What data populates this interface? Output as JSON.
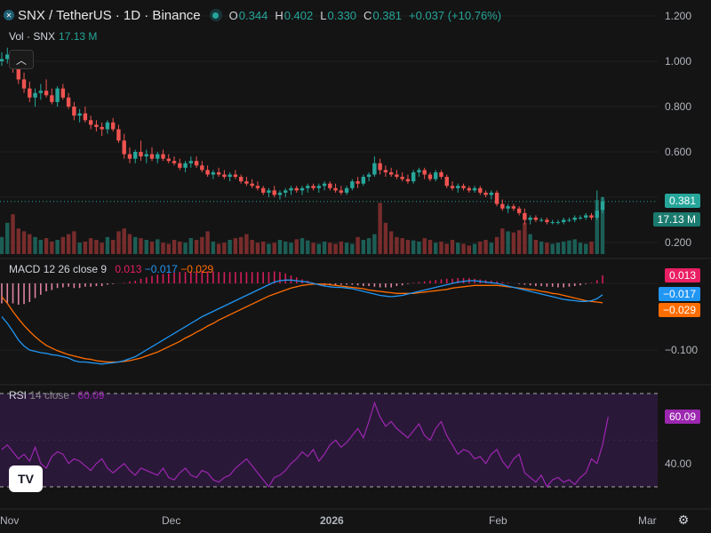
{
  "header": {
    "title": "SNX / TetherUS · 1D · Binance",
    "open_label": "O",
    "open": "0.344",
    "high_label": "H",
    "high": "0.402",
    "low_label": "L",
    "low": "0.330",
    "close_label": "C",
    "close": "0.381",
    "change": "+0.037 (+10.76%)"
  },
  "volume": {
    "label": "Vol · SNX",
    "value": "17.13 M"
  },
  "macd": {
    "label": "MACD",
    "params": "12 26 close 9",
    "hist": "0.013",
    "macd": "−0.017",
    "signal": "−0.029"
  },
  "rsi": {
    "label": "RSI",
    "params": "14 close",
    "value": "60.09"
  },
  "price_tags": {
    "last": "0.381",
    "volume": "17.13 M",
    "macd_hist": "0.013",
    "macd": "−0.017",
    "signal": "−0.029",
    "rsi": "60.09"
  },
  "colors": {
    "up": "#26a69a",
    "down": "#ef5350",
    "macd_line": "#2196f3",
    "signal_line": "#ff6d00",
    "macd_hist": "#e91e63",
    "rsi": "#9c27b0"
  },
  "chart_data": {
    "type": "candlestick",
    "price_axis": [
      {
        "value": 1.2,
        "label": "1.200"
      },
      {
        "value": 1.0,
        "label": "1.000"
      },
      {
        "value": 0.8,
        "label": "0.800"
      },
      {
        "value": 0.6,
        "label": "0.600"
      },
      {
        "value": 0.2,
        "label": "0.200"
      }
    ],
    "macd_axis": [
      {
        "value": -0.1,
        "label": "−0.100"
      }
    ],
    "rsi_axis": [
      {
        "value": 40,
        "label": "40.00"
      }
    ],
    "rsi_bands": [
      70,
      30
    ],
    "x_labels": [
      "Nov",
      "Dec",
      "2026",
      "Feb",
      "Mar"
    ],
    "ohlc": [
      [
        1.0,
        1.04,
        0.98,
        1.01
      ],
      [
        1.01,
        1.06,
        0.99,
        1.03
      ],
      [
        1.03,
        1.05,
        0.95,
        0.98
      ],
      [
        0.98,
        1.0,
        0.9,
        0.92
      ],
      [
        0.92,
        0.95,
        0.86,
        0.88
      ],
      [
        0.88,
        0.91,
        0.82,
        0.84
      ],
      [
        0.84,
        0.88,
        0.8,
        0.86
      ],
      [
        0.86,
        0.9,
        0.83,
        0.87
      ],
      [
        0.87,
        0.92,
        0.84,
        0.85
      ],
      [
        0.85,
        0.88,
        0.81,
        0.82
      ],
      [
        0.82,
        0.89,
        0.8,
        0.88
      ],
      [
        0.88,
        0.9,
        0.83,
        0.84
      ],
      [
        0.84,
        0.86,
        0.79,
        0.8
      ],
      [
        0.8,
        0.82,
        0.74,
        0.76
      ],
      [
        0.76,
        0.79,
        0.73,
        0.77
      ],
      [
        0.77,
        0.8,
        0.73,
        0.74
      ],
      [
        0.74,
        0.76,
        0.7,
        0.72
      ],
      [
        0.72,
        0.74,
        0.69,
        0.71
      ],
      [
        0.71,
        0.73,
        0.67,
        0.7
      ],
      [
        0.7,
        0.74,
        0.68,
        0.73
      ],
      [
        0.73,
        0.75,
        0.69,
        0.7
      ],
      [
        0.7,
        0.72,
        0.64,
        0.65
      ],
      [
        0.65,
        0.68,
        0.57,
        0.59
      ],
      [
        0.59,
        0.62,
        0.55,
        0.57
      ],
      [
        0.57,
        0.61,
        0.55,
        0.6
      ],
      [
        0.6,
        0.65,
        0.56,
        0.58
      ],
      [
        0.58,
        0.61,
        0.55,
        0.59
      ],
      [
        0.59,
        0.62,
        0.56,
        0.57
      ],
      [
        0.57,
        0.6,
        0.55,
        0.59
      ],
      [
        0.59,
        0.61,
        0.56,
        0.57
      ],
      [
        0.57,
        0.59,
        0.55,
        0.56
      ],
      [
        0.56,
        0.58,
        0.54,
        0.55
      ],
      [
        0.55,
        0.57,
        0.52,
        0.53
      ],
      [
        0.53,
        0.56,
        0.51,
        0.55
      ],
      [
        0.55,
        0.58,
        0.53,
        0.56
      ],
      [
        0.56,
        0.58,
        0.53,
        0.54
      ],
      [
        0.54,
        0.56,
        0.51,
        0.52
      ],
      [
        0.52,
        0.54,
        0.49,
        0.5
      ],
      [
        0.5,
        0.52,
        0.48,
        0.51
      ],
      [
        0.51,
        0.53,
        0.49,
        0.5
      ],
      [
        0.5,
        0.52,
        0.48,
        0.49
      ],
      [
        0.49,
        0.51,
        0.47,
        0.5
      ],
      [
        0.5,
        0.52,
        0.48,
        0.49
      ],
      [
        0.49,
        0.5,
        0.46,
        0.47
      ],
      [
        0.47,
        0.49,
        0.45,
        0.46
      ],
      [
        0.46,
        0.48,
        0.44,
        0.45
      ],
      [
        0.45,
        0.47,
        0.43,
        0.44
      ],
      [
        0.44,
        0.45,
        0.41,
        0.42
      ],
      [
        0.42,
        0.44,
        0.4,
        0.43
      ],
      [
        0.43,
        0.45,
        0.4,
        0.41
      ],
      [
        0.41,
        0.43,
        0.39,
        0.42
      ],
      [
        0.42,
        0.44,
        0.4,
        0.43
      ],
      [
        0.43,
        0.45,
        0.41,
        0.44
      ],
      [
        0.44,
        0.45,
        0.42,
        0.43
      ],
      [
        0.43,
        0.45,
        0.41,
        0.44
      ],
      [
        0.44,
        0.46,
        0.42,
        0.45
      ],
      [
        0.45,
        0.46,
        0.43,
        0.44
      ],
      [
        0.44,
        0.46,
        0.42,
        0.45
      ],
      [
        0.45,
        0.47,
        0.43,
        0.46
      ],
      [
        0.46,
        0.47,
        0.43,
        0.44
      ],
      [
        0.44,
        0.46,
        0.42,
        0.43
      ],
      [
        0.43,
        0.45,
        0.41,
        0.42
      ],
      [
        0.42,
        0.45,
        0.41,
        0.44
      ],
      [
        0.44,
        0.48,
        0.43,
        0.47
      ],
      [
        0.47,
        0.49,
        0.44,
        0.46
      ],
      [
        0.46,
        0.5,
        0.45,
        0.49
      ],
      [
        0.49,
        0.51,
        0.47,
        0.5
      ],
      [
        0.5,
        0.58,
        0.49,
        0.55
      ],
      [
        0.55,
        0.57,
        0.5,
        0.52
      ],
      [
        0.52,
        0.54,
        0.49,
        0.51
      ],
      [
        0.51,
        0.53,
        0.49,
        0.5
      ],
      [
        0.5,
        0.52,
        0.48,
        0.49
      ],
      [
        0.49,
        0.51,
        0.47,
        0.48
      ],
      [
        0.48,
        0.5,
        0.46,
        0.47
      ],
      [
        0.47,
        0.52,
        0.46,
        0.51
      ],
      [
        0.51,
        0.53,
        0.49,
        0.52
      ],
      [
        0.52,
        0.53,
        0.48,
        0.5
      ],
      [
        0.5,
        0.51,
        0.47,
        0.48
      ],
      [
        0.48,
        0.52,
        0.47,
        0.51
      ],
      [
        0.51,
        0.52,
        0.48,
        0.49
      ],
      [
        0.49,
        0.5,
        0.44,
        0.45
      ],
      [
        0.45,
        0.47,
        0.43,
        0.44
      ],
      [
        0.44,
        0.46,
        0.42,
        0.45
      ],
      [
        0.45,
        0.46,
        0.43,
        0.44
      ],
      [
        0.44,
        0.45,
        0.42,
        0.43
      ],
      [
        0.43,
        0.45,
        0.42,
        0.44
      ],
      [
        0.44,
        0.45,
        0.41,
        0.42
      ],
      [
        0.42,
        0.43,
        0.4,
        0.41
      ],
      [
        0.41,
        0.43,
        0.39,
        0.42
      ],
      [
        0.42,
        0.43,
        0.36,
        0.37
      ],
      [
        0.37,
        0.39,
        0.34,
        0.35
      ],
      [
        0.35,
        0.37,
        0.33,
        0.36
      ],
      [
        0.36,
        0.37,
        0.34,
        0.35
      ],
      [
        0.35,
        0.36,
        0.32,
        0.33
      ],
      [
        0.33,
        0.35,
        0.28,
        0.3
      ],
      [
        0.3,
        0.32,
        0.28,
        0.31
      ],
      [
        0.31,
        0.32,
        0.29,
        0.3
      ],
      [
        0.3,
        0.31,
        0.29,
        0.3
      ],
      [
        0.3,
        0.31,
        0.28,
        0.29
      ],
      [
        0.29,
        0.3,
        0.28,
        0.29
      ],
      [
        0.29,
        0.3,
        0.28,
        0.29
      ],
      [
        0.29,
        0.31,
        0.28,
        0.3
      ],
      [
        0.3,
        0.31,
        0.29,
        0.3
      ],
      [
        0.3,
        0.32,
        0.29,
        0.31
      ],
      [
        0.31,
        0.32,
        0.3,
        0.31
      ],
      [
        0.31,
        0.33,
        0.3,
        0.32
      ],
      [
        0.32,
        0.33,
        0.3,
        0.31
      ],
      [
        0.31,
        0.43,
        0.3,
        0.34
      ],
      [
        0.344,
        0.402,
        0.33,
        0.381
      ]
    ],
    "volume_level": [
      0.3,
      0.55,
      0.7,
      0.45,
      0.4,
      0.35,
      0.3,
      0.25,
      0.28,
      0.22,
      0.25,
      0.3,
      0.35,
      0.4,
      0.2,
      0.22,
      0.28,
      0.25,
      0.2,
      0.3,
      0.25,
      0.4,
      0.45,
      0.35,
      0.3,
      0.28,
      0.25,
      0.22,
      0.26,
      0.2,
      0.18,
      0.25,
      0.22,
      0.2,
      0.28,
      0.25,
      0.3,
      0.4,
      0.22,
      0.18,
      0.2,
      0.25,
      0.28,
      0.3,
      0.35,
      0.25,
      0.2,
      0.22,
      0.18,
      0.2,
      0.25,
      0.22,
      0.2,
      0.26,
      0.28,
      0.24,
      0.2,
      0.18,
      0.22,
      0.2,
      0.18,
      0.22,
      0.2,
      0.18,
      0.3,
      0.25,
      0.28,
      0.35,
      0.9,
      0.55,
      0.4,
      0.3,
      0.28,
      0.25,
      0.24,
      0.22,
      0.28,
      0.25,
      0.2,
      0.22,
      0.18,
      0.25,
      0.2,
      0.18,
      0.15,
      0.18,
      0.22,
      0.25,
      0.2,
      0.3,
      0.45,
      0.4,
      0.38,
      0.42,
      0.55,
      0.35,
      0.25,
      0.22,
      0.2,
      0.18,
      0.2,
      0.22,
      0.24,
      0.26,
      0.2,
      0.18,
      0.22,
      0.95,
      1.0
    ],
    "macd_series": [
      -0.05,
      -0.06,
      -0.072,
      -0.085,
      -0.094,
      -0.1,
      -0.102,
      -0.104,
      -0.105,
      -0.107,
      -0.108,
      -0.11,
      -0.112,
      -0.116,
      -0.118,
      -0.118,
      -0.119,
      -0.12,
      -0.121,
      -0.12,
      -0.119,
      -0.118,
      -0.116,
      -0.113,
      -0.11,
      -0.105,
      -0.1,
      -0.095,
      -0.09,
      -0.085,
      -0.08,
      -0.075,
      -0.07,
      -0.065,
      -0.06,
      -0.055,
      -0.05,
      -0.046,
      -0.042,
      -0.038,
      -0.034,
      -0.03,
      -0.026,
      -0.022,
      -0.018,
      -0.014,
      -0.01,
      -0.006,
      -0.002,
      0.002,
      0.004,
      0.005,
      0.005,
      0.004,
      0.003,
      0.002,
      0.0,
      -0.002,
      -0.004,
      -0.005,
      -0.006,
      -0.006,
      -0.007,
      -0.008,
      -0.01,
      -0.012,
      -0.014,
      -0.016,
      -0.018,
      -0.019,
      -0.02,
      -0.019,
      -0.018,
      -0.016,
      -0.014,
      -0.012,
      -0.01,
      -0.008,
      -0.006,
      -0.004,
      -0.002,
      0.0,
      0.002,
      0.003,
      0.004,
      0.004,
      0.003,
      0.002,
      0.001,
      0.0,
      -0.002,
      -0.004,
      -0.006,
      -0.008,
      -0.01,
      -0.012,
      -0.014,
      -0.016,
      -0.018,
      -0.02,
      -0.022,
      -0.024,
      -0.025,
      -0.026,
      -0.027,
      -0.027,
      -0.026,
      -0.023,
      -0.017
    ],
    "signal_series": [
      -0.02,
      -0.03,
      -0.042,
      -0.053,
      -0.063,
      -0.072,
      -0.08,
      -0.087,
      -0.093,
      -0.097,
      -0.101,
      -0.104,
      -0.107,
      -0.109,
      -0.111,
      -0.113,
      -0.114,
      -0.116,
      -0.117,
      -0.118,
      -0.118,
      -0.118,
      -0.117,
      -0.116,
      -0.114,
      -0.112,
      -0.109,
      -0.106,
      -0.103,
      -0.099,
      -0.095,
      -0.091,
      -0.087,
      -0.082,
      -0.078,
      -0.073,
      -0.069,
      -0.064,
      -0.06,
      -0.055,
      -0.051,
      -0.047,
      -0.043,
      -0.039,
      -0.035,
      -0.031,
      -0.027,
      -0.023,
      -0.019,
      -0.016,
      -0.013,
      -0.01,
      -0.007,
      -0.005,
      -0.003,
      -0.002,
      -0.001,
      -0.001,
      -0.001,
      -0.002,
      -0.003,
      -0.004,
      -0.005,
      -0.006,
      -0.007,
      -0.008,
      -0.01,
      -0.011,
      -0.012,
      -0.013,
      -0.014,
      -0.015,
      -0.015,
      -0.015,
      -0.015,
      -0.014,
      -0.013,
      -0.012,
      -0.011,
      -0.01,
      -0.009,
      -0.007,
      -0.006,
      -0.005,
      -0.004,
      -0.003,
      -0.003,
      -0.003,
      -0.003,
      -0.003,
      -0.004,
      -0.005,
      -0.006,
      -0.007,
      -0.008,
      -0.009,
      -0.01,
      -0.012,
      -0.013,
      -0.015,
      -0.016,
      -0.018,
      -0.02,
      -0.022,
      -0.024,
      -0.026,
      -0.027,
      -0.028,
      -0.029
    ],
    "rsi_series": [
      46,
      48,
      45,
      42,
      44,
      41,
      47,
      40,
      38,
      43,
      45,
      44,
      40,
      42,
      41,
      39,
      37,
      40,
      42,
      38,
      36,
      38,
      40,
      37,
      35,
      38,
      37,
      36,
      35,
      38,
      34,
      33,
      36,
      38,
      35,
      34,
      37,
      36,
      33,
      32,
      34,
      35,
      38,
      40,
      42,
      39,
      36,
      33,
      30,
      34,
      35,
      37,
      40,
      42,
      45,
      43,
      46,
      41,
      44,
      48,
      50,
      47,
      49,
      52,
      55,
      51,
      58,
      66,
      60,
      56,
      58,
      55,
      53,
      51,
      54,
      57,
      52,
      50,
      55,
      58,
      52,
      48,
      44,
      46,
      45,
      42,
      43,
      40,
      44,
      46,
      41,
      38,
      42,
      44,
      36,
      34,
      32,
      35,
      30,
      33,
      34,
      32,
      33,
      31,
      34,
      36,
      42,
      40,
      48,
      60
    ],
    "n_bars": 109
  }
}
